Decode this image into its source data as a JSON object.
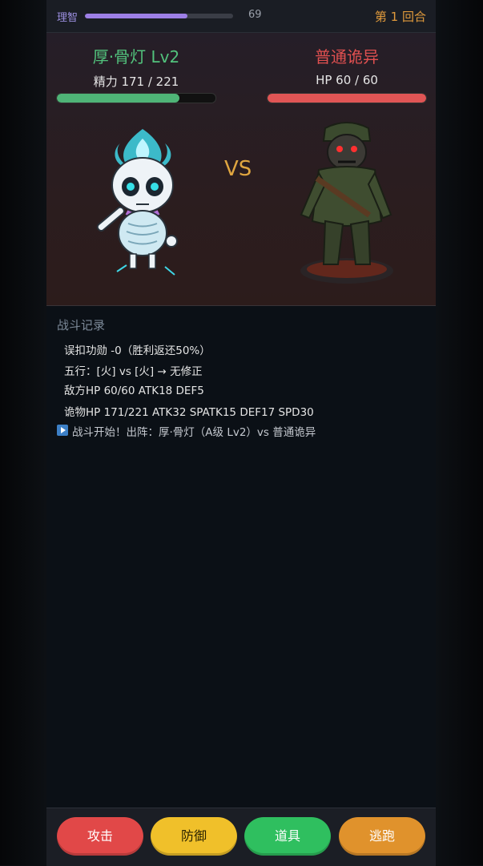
{
  "topbar": {
    "sanity_label": "理智",
    "sanity_value": "69",
    "sanity_fraction": 0.69,
    "round_label": "第 1 回合"
  },
  "battle": {
    "player": {
      "name": "厚·骨灯 Lv2",
      "stat_text": "精力 171 / 221",
      "energy_current": 171,
      "energy_max": 221,
      "color": "#52c27c"
    },
    "vs_label": "VS",
    "enemy": {
      "name": "普通诡异",
      "stat_text": "HP 60 / 60",
      "hp_current": 60,
      "hp_max": 60,
      "color": "#e05050"
    }
  },
  "log": {
    "title": "战斗记录",
    "lines": [
      "误扣功勋 -0（胜利返还50%）",
      "五行：[火] vs [火] → 无修正",
      "敌方HP 60/60 ATK18 DEF5",
      "诡物HP 171/221 ATK32 SPATK15 DEF17 SPD30",
      "战斗开始！出阵：厚·骨灯（A级 Lv2）vs 普通诡异"
    ]
  },
  "actions": {
    "attack": "攻击",
    "defend": "防御",
    "item": "道具",
    "flee": "逃跑"
  }
}
